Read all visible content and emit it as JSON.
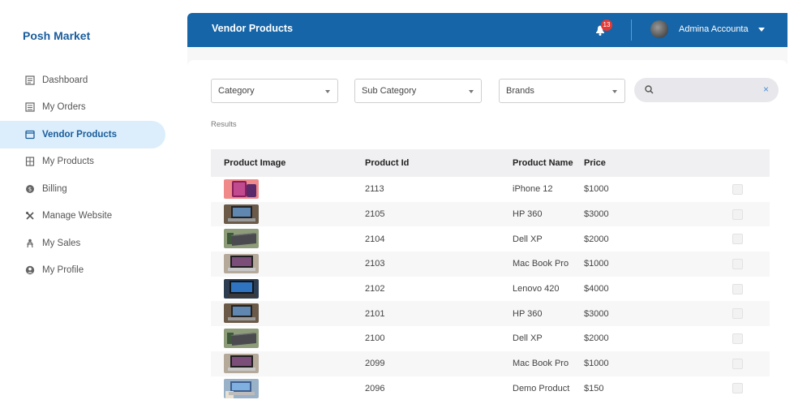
{
  "brand": "Posh Market",
  "sidebar": {
    "items": [
      {
        "label": "Dashboard",
        "icon": "dashboard-icon"
      },
      {
        "label": "My Orders",
        "icon": "orders-icon"
      },
      {
        "label": "Vendor Products",
        "icon": "vendor-products-icon",
        "active": true
      },
      {
        "label": "My Products",
        "icon": "products-icon"
      },
      {
        "label": "Billing",
        "icon": "billing-icon"
      },
      {
        "label": "Manage Website",
        "icon": "tools-icon"
      },
      {
        "label": "My Sales",
        "icon": "sales-icon"
      },
      {
        "label": "My Profile",
        "icon": "profile-icon"
      }
    ]
  },
  "header": {
    "title": "Vendor Products",
    "notification_count": "13",
    "user_name": "Admina Accounta"
  },
  "filters": {
    "category": "Category",
    "sub_category": "Sub Category",
    "brands": "Brands",
    "search_placeholder": "",
    "clear": "×"
  },
  "results_label": "Results",
  "table": {
    "headers": [
      "Product Image",
      "Product Id",
      "Product Name",
      "Price"
    ],
    "rows": [
      {
        "id": "2113",
        "name": "iPhone 12",
        "price": "$1000",
        "thumb": "phone"
      },
      {
        "id": "2105",
        "name": "HP 360",
        "price": "$3000",
        "thumb": "laptop"
      },
      {
        "id": "2104",
        "name": "Dell XP",
        "price": "$2000",
        "thumb": "laptop-closed"
      },
      {
        "id": "2103",
        "name": "Mac Book Pro",
        "price": "$1000",
        "thumb": "macbook"
      },
      {
        "id": "2102",
        "name": "Lenovo 420",
        "price": "$4000",
        "thumb": "laptop-blue"
      },
      {
        "id": "2101",
        "name": "HP 360",
        "price": "$3000",
        "thumb": "laptop"
      },
      {
        "id": "2100",
        "name": "Dell XP",
        "price": "$2000",
        "thumb": "laptop-closed"
      },
      {
        "id": "2099",
        "name": "Mac Book Pro",
        "price": "$1000",
        "thumb": "macbook"
      },
      {
        "id": "2096",
        "name": "Demo Product",
        "price": "$150",
        "thumb": "demo"
      }
    ]
  },
  "colors": {
    "header_bg": "#1565a8",
    "accent": "#1a5c9c",
    "active_bg": "#dceefb",
    "badge": "#e53935"
  }
}
